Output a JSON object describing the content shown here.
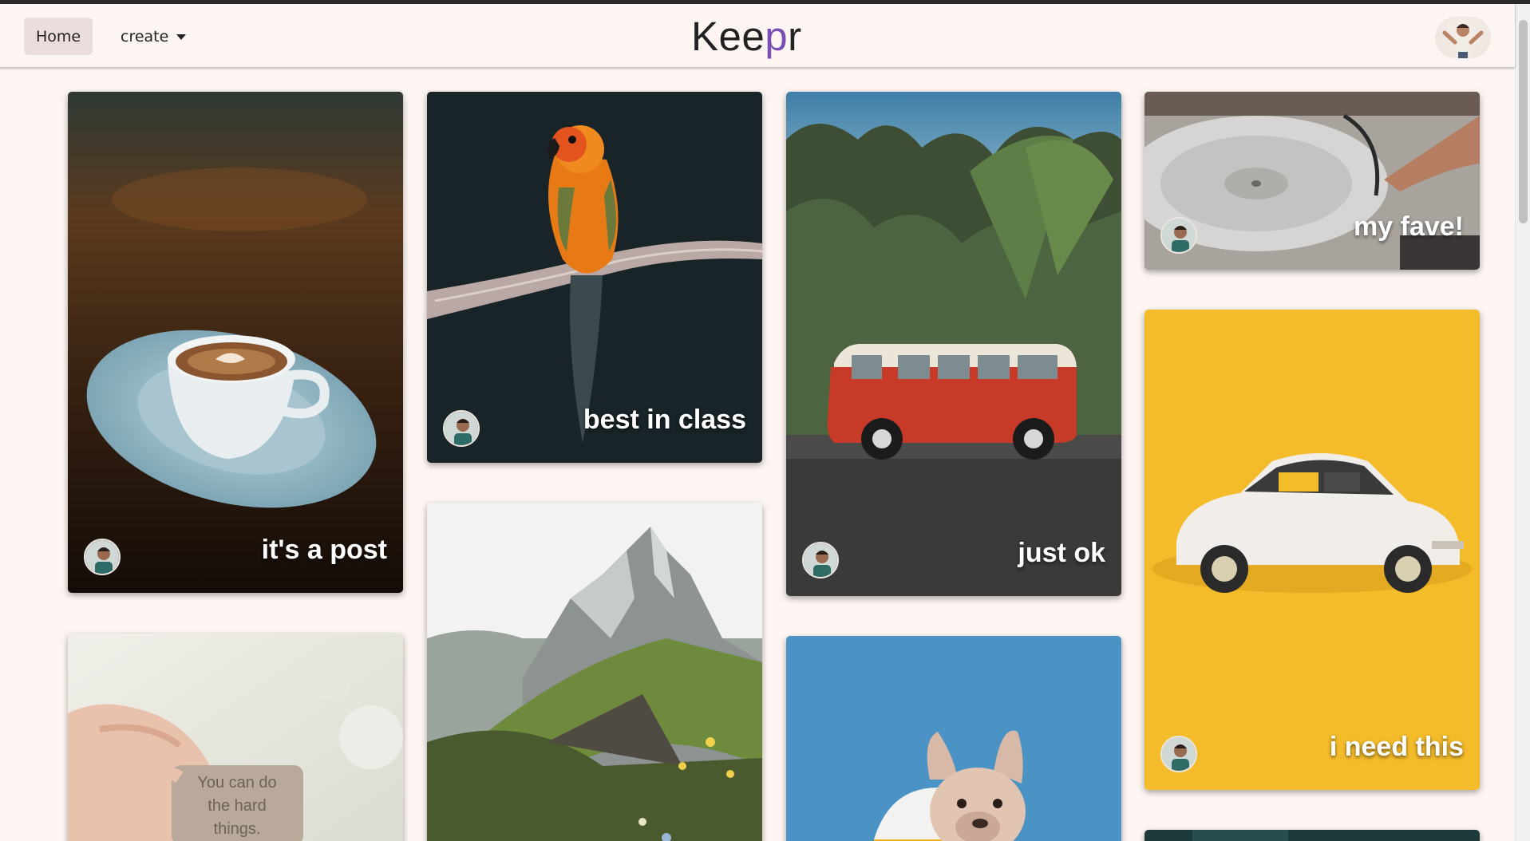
{
  "nav": {
    "home_label": "Home",
    "create_label": "create",
    "brand_prefix": "Kee",
    "brand_accent": "p",
    "brand_suffix": "r"
  },
  "colors": {
    "background": "#fdf5f1",
    "brand_accent": "#7a4fb5",
    "home_pill": "#eadddb"
  },
  "keeps": [
    {
      "title": "it's a post",
      "image": "coffee cup on saucer"
    },
    {
      "title": "best in class",
      "image": "parrot on branch"
    },
    {
      "title": "just ok",
      "image": "red vintage van"
    },
    {
      "title": "my fave!",
      "image": "record player"
    },
    {
      "title": "i need this",
      "image": "white toy car on yellow"
    },
    {
      "title": "",
      "image": "hand holding 'you can do the hard things' stone",
      "stone_text": "You can do the hard things."
    },
    {
      "title": "",
      "image": "mountain peaks"
    },
    {
      "title": "",
      "image": "dog in hoodie on blue"
    },
    {
      "title": "",
      "image": "dark teal photo (cut off)"
    }
  ]
}
